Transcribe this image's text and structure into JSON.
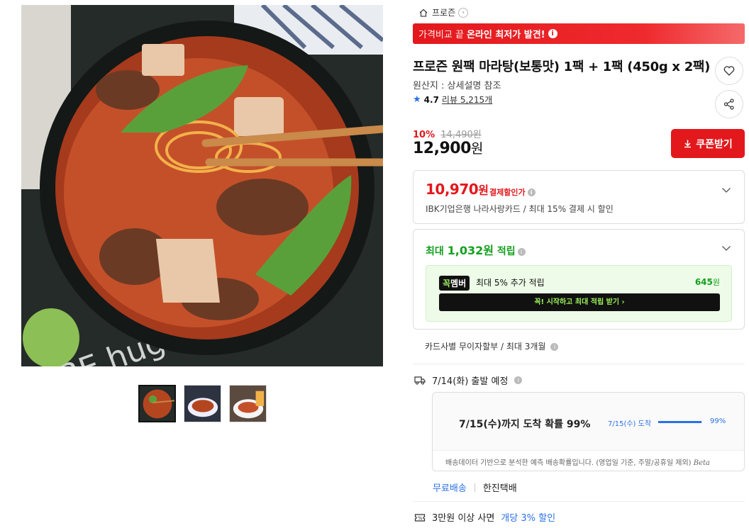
{
  "breadcrumb": {
    "label": "프로즌"
  },
  "banner": {
    "prefix": "가격비교 끝",
    "strong": "온라인 최저가 발견!",
    "info": "i"
  },
  "product": {
    "title": "프로즌 원팩 마라탕(보통맛) 1팩 + 1팩 (450g x 2팩)",
    "origin": "원산지 : 상세설명 참조",
    "rating": "4.7",
    "reviews": "리뷰 5,215개"
  },
  "pricing": {
    "discount_rate": "10%",
    "original_price": "14,490원",
    "price_number": "12,900",
    "price_unit": "원",
    "coupon_label": "쿠폰받기"
  },
  "card_discount": {
    "amount_number": "10,970",
    "amount_unit": "원",
    "label": "결제할인가",
    "detail": "IBK기업은행 나라사랑카드 / 최대 15% 결제 시 할인"
  },
  "rewards": {
    "prefix": "최대",
    "amount": "1,032원",
    "suffix": "적립",
    "member_badge_a": "꼭",
    "member_badge_b": "멤버",
    "member_text": "최대 5% 추가 적립",
    "member_points_number": "645",
    "member_points_unit": "원",
    "cta": "꼭! 시작하고 최대 적립 받기  ›"
  },
  "installment": {
    "text": "카드사별 무이자할부 / 최대 3개월"
  },
  "shipping": {
    "departure": "7/14(화) 출발 예정",
    "probability_headline": "7/15(수)까지 도착 확률 99%",
    "eta_label": "7/15(수) 도착",
    "probability": 0.99,
    "probability_label": "99%",
    "note": "배송데이터 기반으로 분석한 예측 배송확률입니다. (영업일 기준, 주말/공휴일 제외)",
    "beta": "Beta",
    "free_label": "무료배송",
    "carrier": "한진택배"
  },
  "promo": {
    "text": "3만원 이상 사면",
    "highlight": "개당 3% 할인"
  },
  "colors": {
    "accent_red": "#e3181c",
    "accent_blue": "#2b6fe8",
    "accent_green": "#14a01e"
  },
  "icons": [
    "home-icon",
    "heart-icon",
    "share-icon",
    "download-icon",
    "chevron-down-icon",
    "truck-icon",
    "coupon-icon",
    "star-icon",
    "info-icon"
  ]
}
